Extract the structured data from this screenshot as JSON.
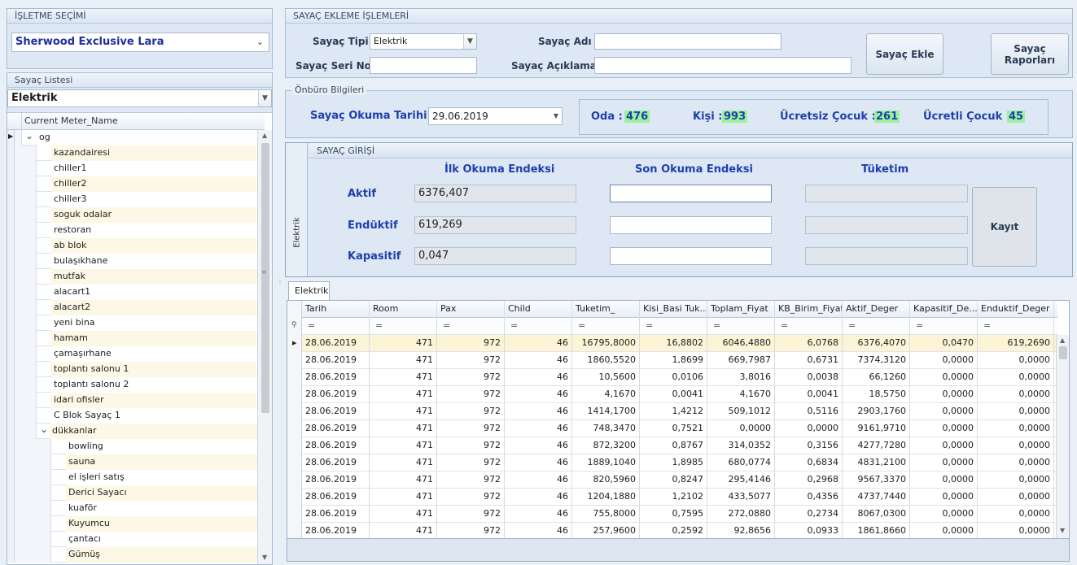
{
  "business": {
    "title": "İŞLETME SEÇİMİ",
    "selected": "Sherwood Exclusive Lara"
  },
  "meter_list": {
    "title": "Sayaç Listesi",
    "type_selected": "Elektrik",
    "column_header": "Current Meter_Name",
    "root": "og",
    "items": [
      "kazandairesi",
      "chiller1",
      "chiller2",
      "chiller3",
      "soguk odalar",
      "restoran",
      "ab blok",
      "bulaşıkhane",
      "mutfak",
      "alacart1",
      "alacart2",
      "yeni bina",
      "hamam",
      "çamaşırhane",
      "toplantı salonu 1",
      "toplantı salonu 2",
      "idari ofisler",
      "C Blok Sayaç 1"
    ],
    "group": "dükkanlar",
    "sub_items": [
      "bowling",
      "sauna",
      "el işleri satış",
      "Derici Sayacı",
      "kuaför",
      "Kuyumcu",
      "çantacı",
      "Gümüş"
    ]
  },
  "add_meter": {
    "title": "SAYAÇ EKLEME İŞLEMLERİ",
    "type_label": "Sayaç Tipi",
    "type_value": "Elektrik",
    "serial_label": "Sayaç Seri No",
    "serial_value": "",
    "name_label": "Sayaç Adı",
    "name_value": "",
    "desc_label": "Sayaç Açıklama",
    "desc_value": "",
    "add_button": "Sayaç Ekle",
    "reports_button_line1": "Sayaç",
    "reports_button_line2": "Raporları"
  },
  "front_office": {
    "title": "Önbüro Bilgileri",
    "date_label": "Sayaç Okuma Tarihi",
    "date_value": "29.06.2019",
    "room_label": "Oda :",
    "room_value": "476",
    "pax_label": "Kişi :",
    "pax_value": "993",
    "free_child_label": "Ücretsiz Çocuk :",
    "free_child_value": "261",
    "paid_child_label": "Ücretli Çocuk :",
    "paid_child_value": "45"
  },
  "meter_entry": {
    "title": "SAYAÇ GİRİŞİ",
    "side_tab": "Elektrik",
    "col_first": "İlk Okuma Endeksi",
    "col_last": "Son Okuma Endeksi",
    "col_consumption": "Tüketim",
    "row_aktif": "Aktif",
    "row_enduktif": "Endüktif",
    "row_kapasitif": "Kapasitif",
    "aktif_first": "6376,407",
    "enduktif_first": "619,269",
    "kapasitif_first": "0,047",
    "save_button": "Kayıt"
  },
  "grid": {
    "tab": "Elektrik",
    "filter_glyph": "=",
    "columns": [
      "Tarih",
      "Room",
      "Pax",
      "Child",
      "Tuketim_",
      "Kisi_Basi Tuk...",
      "Toplam_Fiyat",
      "KB_Birim_Fiyat",
      "Aktif_Deger",
      "Kapasitif_De...",
      "Enduktif_Deger"
    ],
    "rows": [
      [
        "28.06.2019",
        "471",
        "972",
        "46",
        "16795,8000",
        "16,8802",
        "6046,4880",
        "6,0768",
        "6376,4070",
        "0,0470",
        "619,2690"
      ],
      [
        "28.06.2019",
        "471",
        "972",
        "46",
        "1860,5520",
        "1,8699",
        "669,7987",
        "0,6731",
        "7374,3120",
        "0,0000",
        "0,0000"
      ],
      [
        "28.06.2019",
        "471",
        "972",
        "46",
        "10,5600",
        "0,0106",
        "3,8016",
        "0,0038",
        "66,1260",
        "0,0000",
        "0,0000"
      ],
      [
        "28.06.2019",
        "471",
        "972",
        "46",
        "4,1670",
        "0,0041",
        "4,1670",
        "0,0041",
        "18,5750",
        "0,0000",
        "0,0000"
      ],
      [
        "28.06.2019",
        "471",
        "972",
        "46",
        "1414,1700",
        "1,4212",
        "509,1012",
        "0,5116",
        "2903,1760",
        "0,0000",
        "0,0000"
      ],
      [
        "28.06.2019",
        "471",
        "972",
        "46",
        "748,3470",
        "0,7521",
        "0,0000",
        "0,0000",
        "9161,9710",
        "0,0000",
        "0,0000"
      ],
      [
        "28.06.2019",
        "471",
        "972",
        "46",
        "872,3200",
        "0,8767",
        "314,0352",
        "0,3156",
        "4277,7280",
        "0,0000",
        "0,0000"
      ],
      [
        "28.06.2019",
        "471",
        "972",
        "46",
        "1889,1040",
        "1,8985",
        "680,0774",
        "0,6834",
        "4831,2100",
        "0,0000",
        "0,0000"
      ],
      [
        "28.06.2019",
        "471",
        "972",
        "46",
        "820,5960",
        "0,8247",
        "295,4146",
        "0,2968",
        "9567,3370",
        "0,0000",
        "0,0000"
      ],
      [
        "28.06.2019",
        "471",
        "972",
        "46",
        "1204,1880",
        "1,2102",
        "433,5077",
        "0,4356",
        "4737,7440",
        "0,0000",
        "0,0000"
      ],
      [
        "28.06.2019",
        "471",
        "972",
        "46",
        "755,8000",
        "0,7595",
        "272,0880",
        "0,2734",
        "8067,0300",
        "0,0000",
        "0,0000"
      ],
      [
        "28.06.2019",
        "471",
        "972",
        "46",
        "257,9600",
        "0,2592",
        "92,8656",
        "0,0933",
        "1861,8660",
        "0,0000",
        "0,0000"
      ]
    ]
  }
}
